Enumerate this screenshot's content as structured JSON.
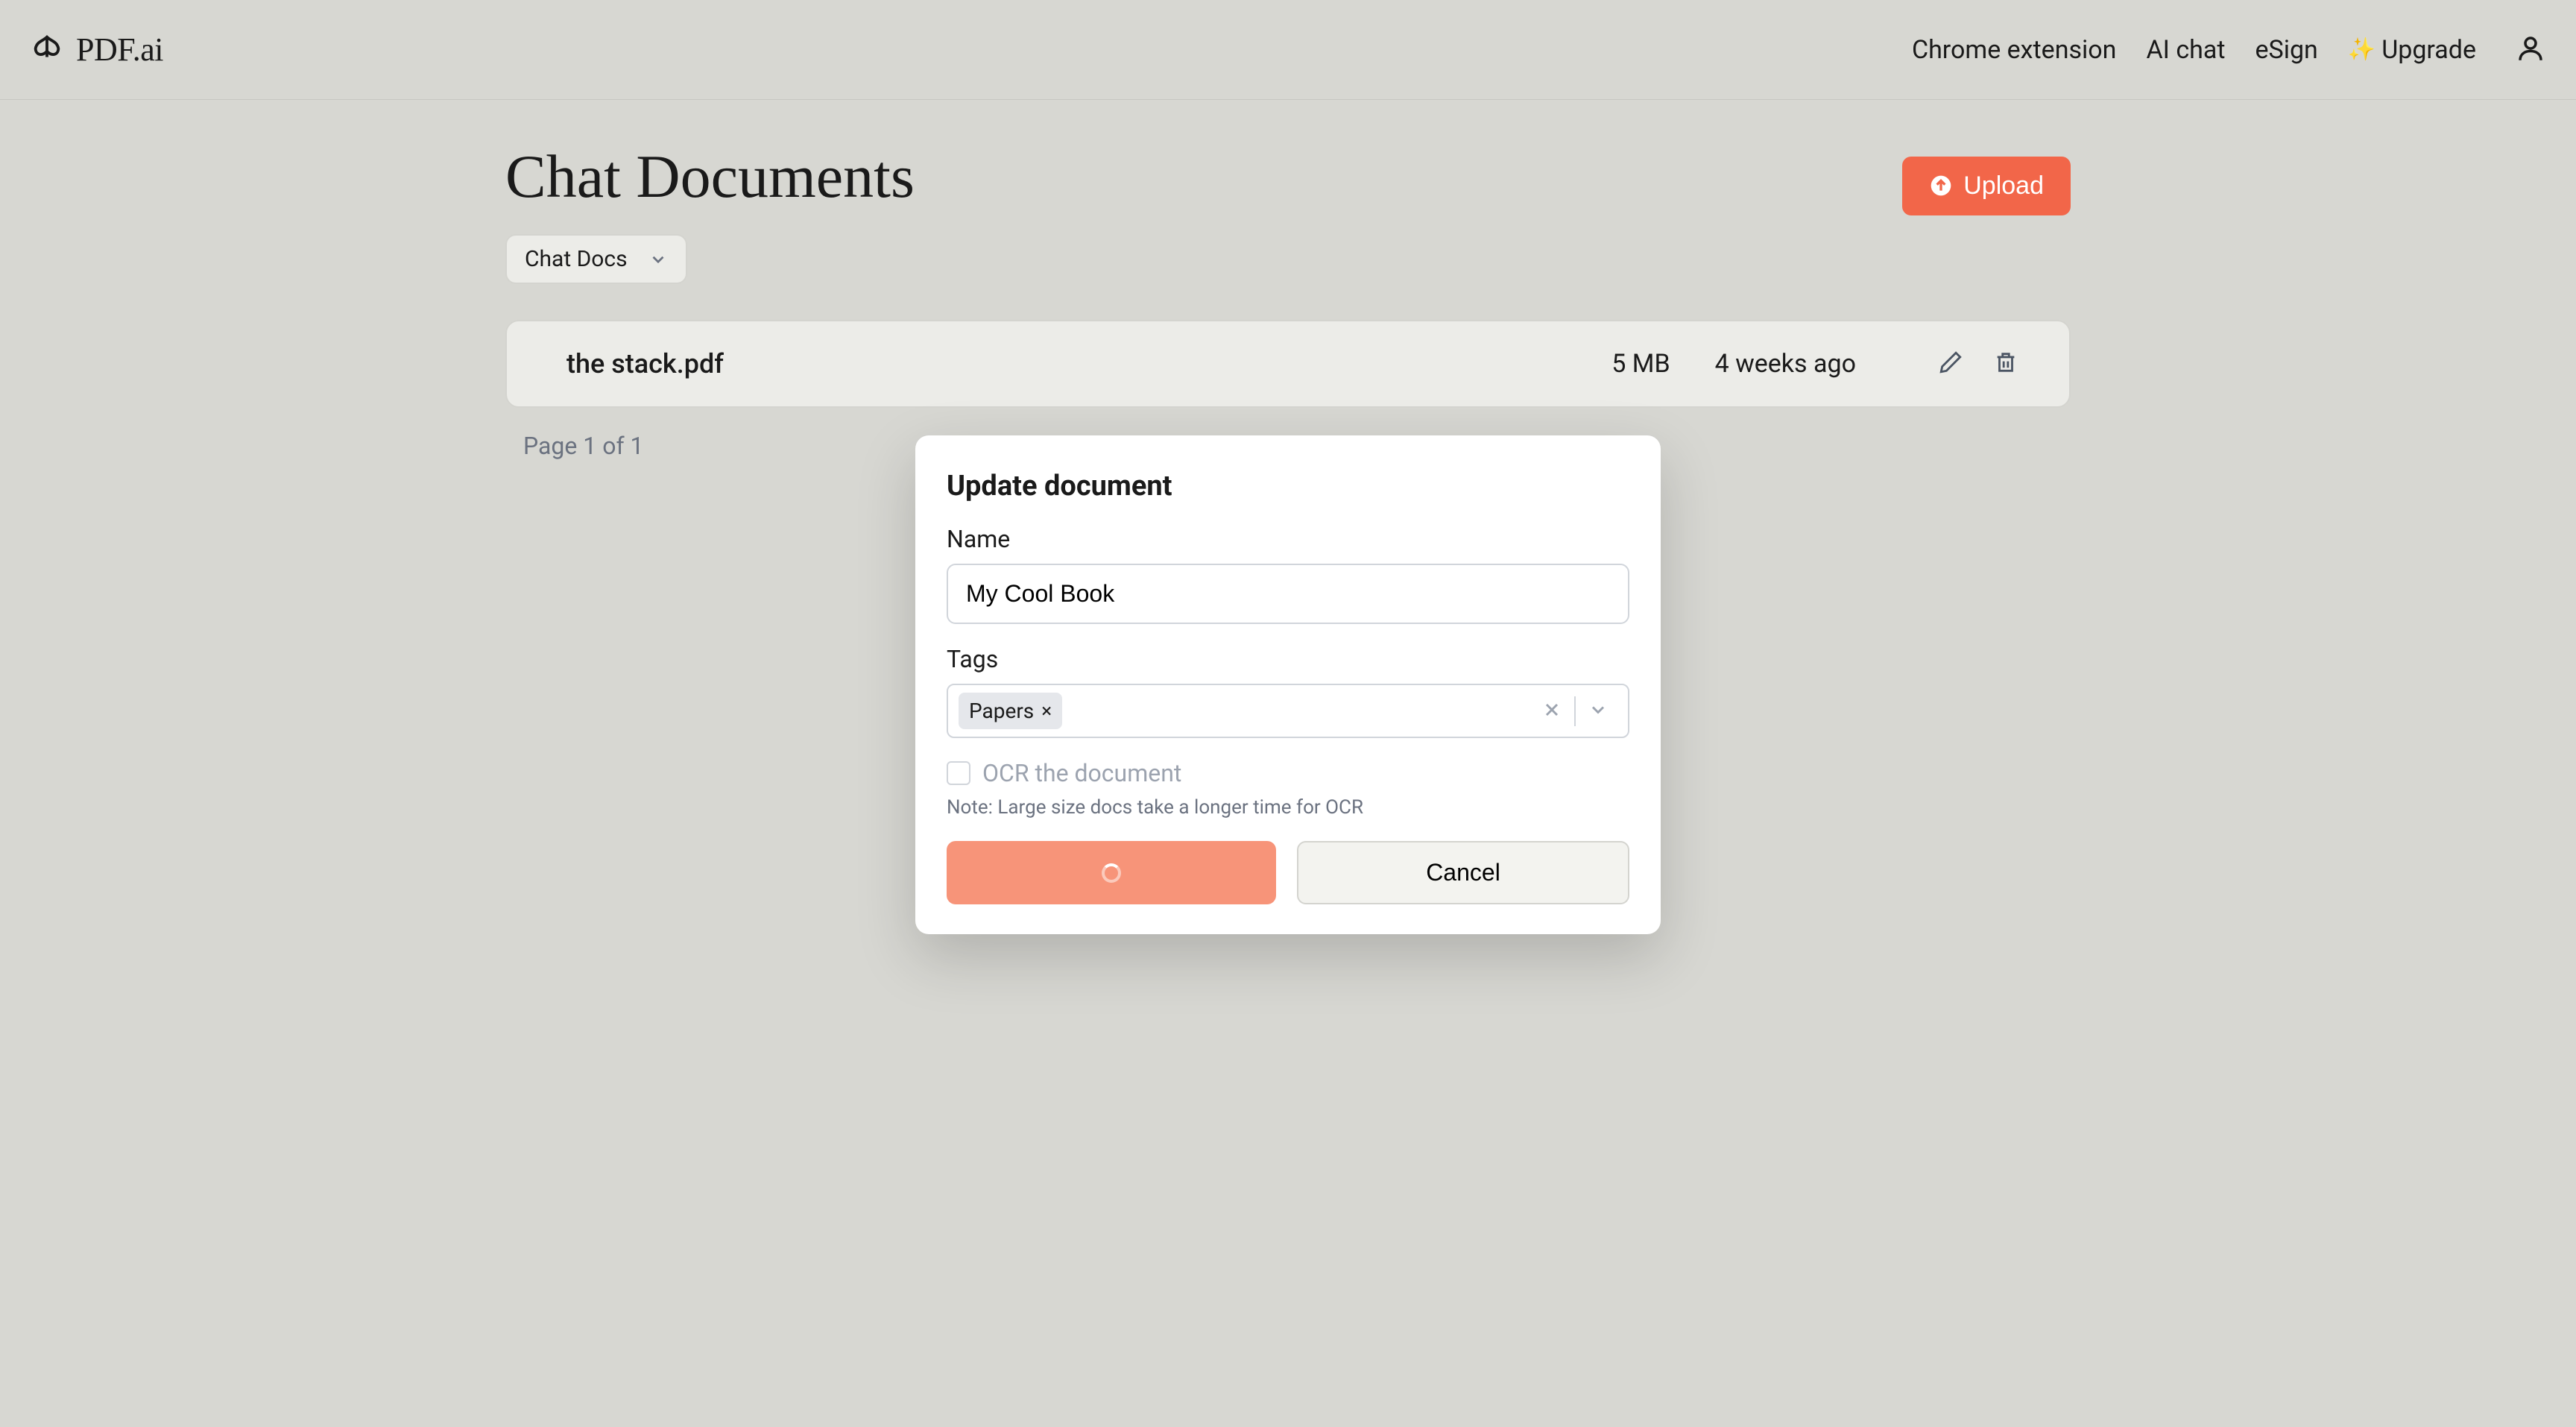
{
  "header": {
    "brand": "PDF.ai",
    "nav": {
      "chrome_extension": "Chrome extension",
      "ai_chat": "AI chat",
      "esign": "eSign",
      "upgrade": "Upgrade"
    }
  },
  "main": {
    "title": "Chat Documents",
    "upload_label": "Upload",
    "filter_label": "Chat Docs",
    "documents": [
      {
        "name": "the stack.pdf",
        "size": "5 MB",
        "age": "4 weeks ago"
      }
    ],
    "pagination": "Page 1 of 1"
  },
  "modal": {
    "title": "Update document",
    "name_label": "Name",
    "name_value": "My Cool Book",
    "tags_label": "Tags",
    "tags": [
      "Papers"
    ],
    "ocr_label": "OCR the document",
    "ocr_note": "Note: Large size docs take a longer time for OCR",
    "cancel_label": "Cancel"
  }
}
